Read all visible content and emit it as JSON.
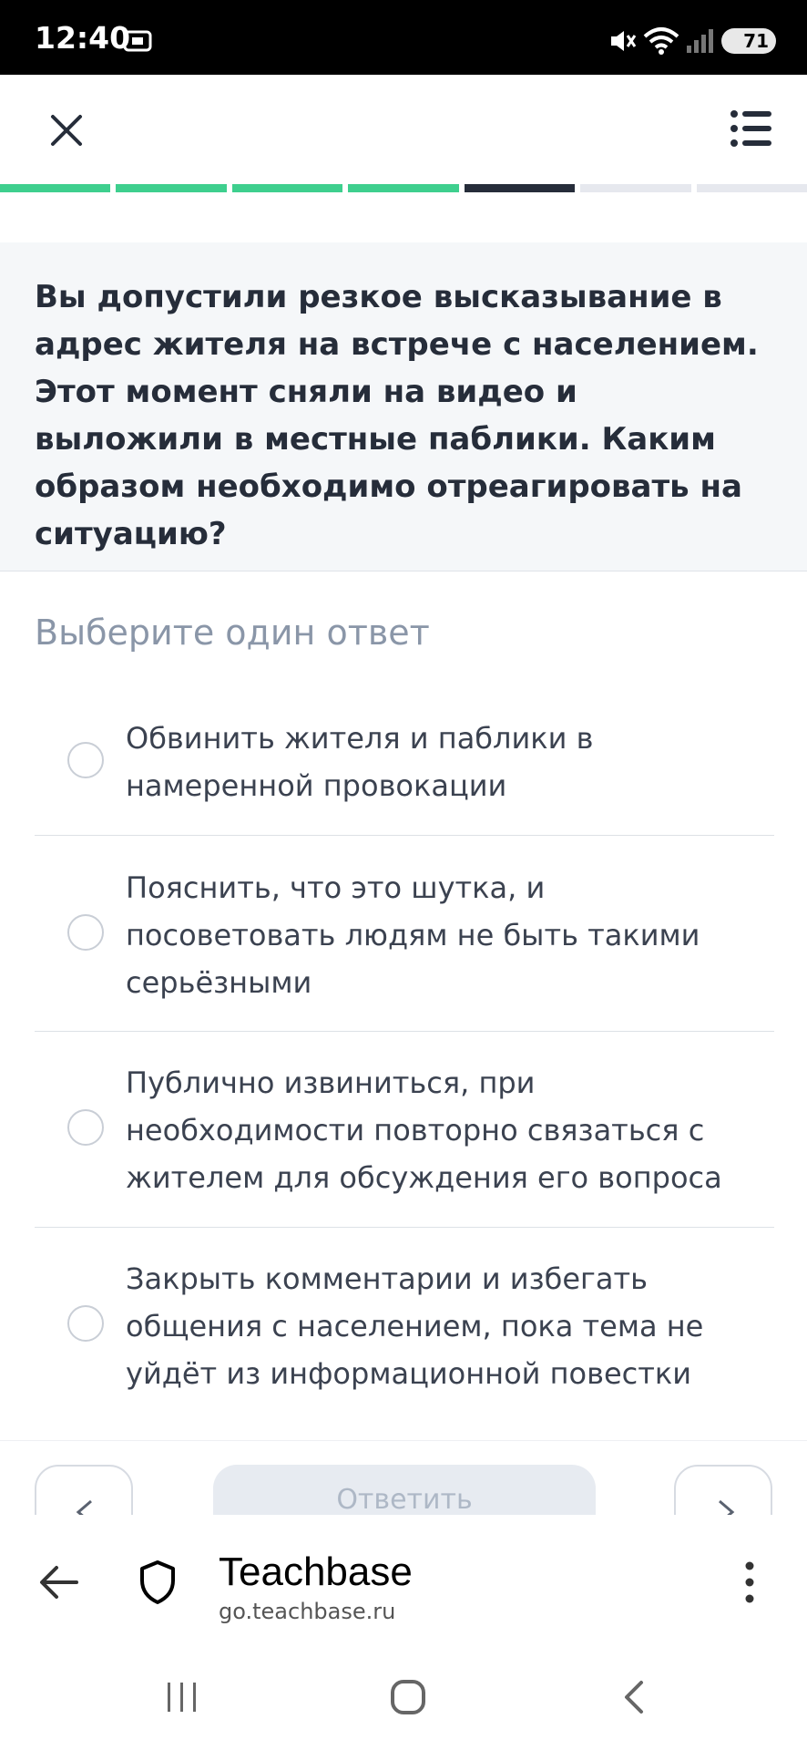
{
  "status_bar": {
    "time": "12:40",
    "battery": "71",
    "icons": [
      "screenshot-icon",
      "mute-icon",
      "wifi-icon",
      "signal-icon",
      "battery-icon"
    ]
  },
  "header": {
    "close_icon": "close-icon",
    "menu_icon": "list-menu-icon"
  },
  "progress": {
    "segments": [
      "done",
      "done",
      "done",
      "done",
      "current",
      "todo",
      "todo"
    ],
    "colors": {
      "done": "#3ecf8e",
      "current": "#262d3a",
      "todo": "#e6e8ee"
    }
  },
  "question": {
    "text": "Вы допустили резкое высказывание в адрес жителя на встрече с населением. Этот момент сняли на видео и выложили в местные паблики. Каким образом необходимо отреагировать на ситуацию?"
  },
  "instruction": "Выберите один ответ",
  "options": [
    {
      "text": "Обвинить жителя и паблики в намеренной провокации"
    },
    {
      "text": "Пояснить, что это шутка, и посоветовать людям не быть такими серьёзными"
    },
    {
      "text": "Публично извиниться, при необходимости повторно связаться с жителем для обсуждения его вопроса"
    },
    {
      "text": "Закрыть комментарии и избегать общения с населением, пока тема не уйдёт из информационной повестки"
    }
  ],
  "actions": {
    "answer_label": "Ответить"
  },
  "browser": {
    "title": "Teachbase",
    "url": "go.teachbase.ru"
  }
}
